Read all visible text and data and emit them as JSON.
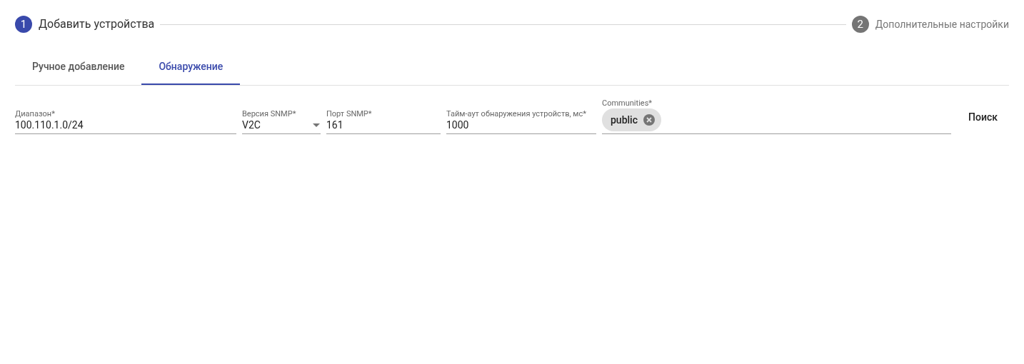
{
  "stepper": [
    {
      "number": "1",
      "label": "Добавить устройства",
      "active": true
    },
    {
      "number": "2",
      "label": "Дополнительные настройки",
      "active": false
    }
  ],
  "tabs": [
    {
      "label": "Ручное добавление",
      "selected": false
    },
    {
      "label": "Обнаружение",
      "selected": true
    }
  ],
  "fields": [
    {
      "kind": "text",
      "label": "Диапазон*",
      "value": "100.110.1.0/24"
    },
    {
      "kind": "select",
      "label": "Версия SNMP*",
      "value": "V2C"
    },
    {
      "kind": "text",
      "label": "Порт SNMP*",
      "value": "161"
    },
    {
      "kind": "text",
      "label": "Тайм-аут обнаружения устройств, мс*",
      "value": "1000"
    },
    {
      "kind": "chips",
      "label": "Communities*",
      "chips": [
        "public"
      ]
    }
  ],
  "search_button": "Поиск"
}
